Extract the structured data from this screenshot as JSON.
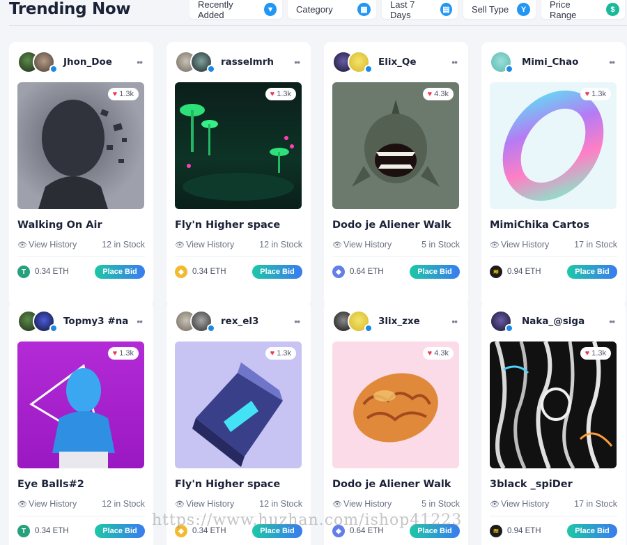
{
  "header": {
    "title": "Trending Now",
    "filters": [
      {
        "label": "Recently Added",
        "icon": "funnel-icon"
      },
      {
        "label": "Category",
        "icon": "grid-icon"
      },
      {
        "label": "Last 7 Days",
        "icon": "calendar-icon"
      },
      {
        "label": "Sell Type",
        "icon": "tag-icon"
      },
      {
        "label": "Price Range",
        "icon": "dollar-icon"
      }
    ]
  },
  "card_labels": {
    "view_history": "View History",
    "place_bid": "Place Bid"
  },
  "cards": [
    {
      "owner": "Jhon_Doe",
      "likes": "1.3k",
      "title": "Walking On Air",
      "stock": "12 in Stock",
      "price": "0.34 ETH",
      "coin": "tether",
      "coin_color": "#26a17b"
    },
    {
      "owner": "rasselmrh",
      "likes": "1.3k",
      "title": "Fly'n Higher space",
      "stock": "12 in Stock",
      "price": "0.34 ETH",
      "coin": "binance",
      "coin_color": "#f3ba2f"
    },
    {
      "owner": "Elix_Qe",
      "likes": "4.3k",
      "title": "Dodo je Aliener Walk",
      "stock": "5 in Stock",
      "price": "0.64 ETH",
      "coin": "ethereum",
      "coin_color": "#627eea"
    },
    {
      "owner": "Mimi_Chao",
      "likes": "1.3k",
      "title": "MimiChika Cartos",
      "stock": "17 in Stock",
      "price": "0.94 ETH",
      "coin": "stripe-coin",
      "coin_color": "#1b1b1b"
    },
    {
      "owner": "Topmy3 #na",
      "likes": "1.3k",
      "title": "Eye Balls#2",
      "stock": "12 in Stock",
      "price": "0.34 ETH",
      "coin": "tether",
      "coin_color": "#26a17b"
    },
    {
      "owner": "rex_el3",
      "likes": "1.3k",
      "title": "Fly'n Higher space",
      "stock": "12 in Stock",
      "price": "0.34 ETH",
      "coin": "binance",
      "coin_color": "#f3ba2f"
    },
    {
      "owner": "3lix_zxe",
      "likes": "4.3k",
      "title": "Dodo je Aliener Walk",
      "stock": "5 in Stock",
      "price": "0.64 ETH",
      "coin": "ethereum",
      "coin_color": "#627eea"
    },
    {
      "owner": "Naka_@siga",
      "likes": "1.3k",
      "title": "3black _spiDer",
      "stock": "17 in Stock",
      "price": "0.94 ETH",
      "coin": "stripe-coin",
      "coin_color": "#1b1b1b"
    }
  ],
  "watermark": "https://www.huzhan.com/ishop41223",
  "colors": {
    "accent_start": "#1dc7a6",
    "accent_end": "#3a7bf0",
    "heart": "#ef3a54",
    "verify": "#1e88e5"
  }
}
